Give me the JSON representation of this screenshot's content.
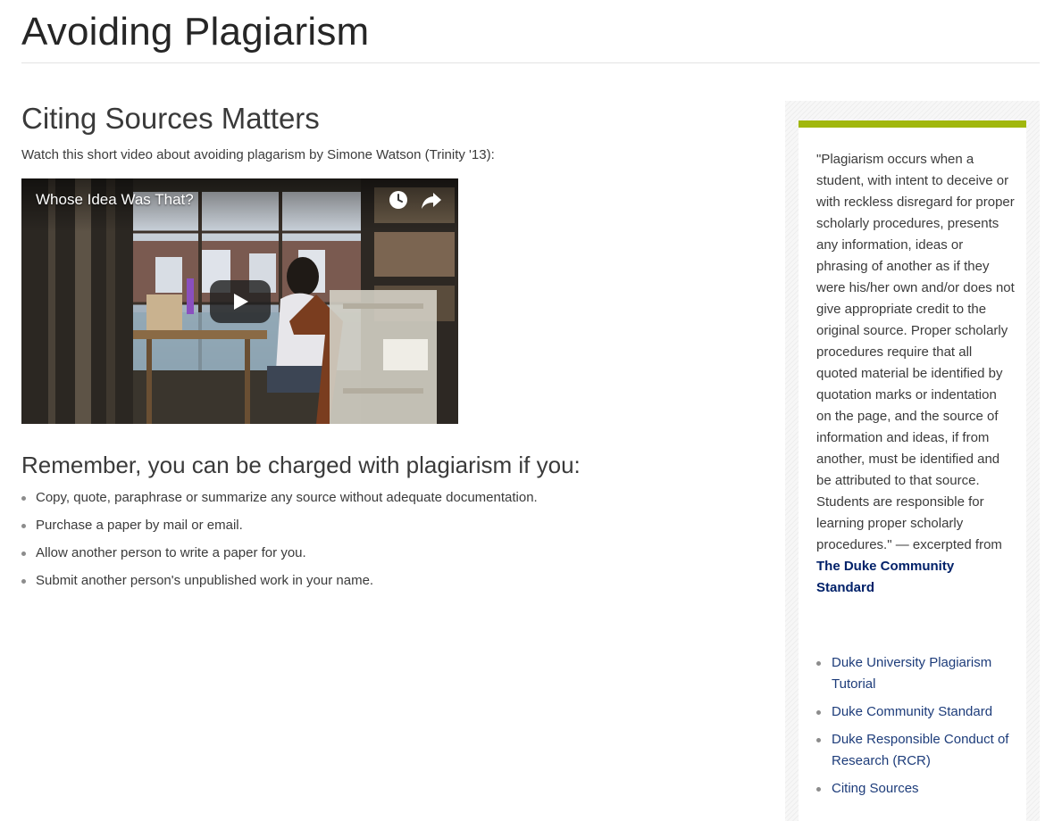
{
  "page": {
    "title": "Avoiding Plagiarism"
  },
  "main": {
    "section_heading": "Citing Sources Matters",
    "intro": "Watch this short video about avoiding plagarism by Simone Watson (Trinity '13):",
    "video": {
      "title": "Whose Idea Was That?",
      "icons": [
        "clock-icon",
        "share-icon",
        "play-icon"
      ]
    },
    "remember_heading": "Remember, you can be charged with plagiarism if you:",
    "remember_items": [
      "Copy, quote, paraphrase or summarize any source without adequate documentation.",
      "Purchase a paper by mail or email.",
      "Allow another person to write a paper for you.",
      "Submit another person's unpublished work in your name."
    ]
  },
  "sidebar": {
    "accent_color": "#a1b70d",
    "quote_text": "\"Plagiarism occurs when a student, with intent to deceive or with reckless disregard for proper scholarly procedures, presents any information, ideas or phrasing of another as if they were his/her own and/or does not give appropriate credit to the original source. Proper scholarly procedures require that all quoted material be identified by quotation marks or indentation on the page, and the source of information and ideas, if from another, must be identified and be attributed to that source. Students are responsible for learning proper scholarly procedures.\"",
    "excerpt_prefix": " — excerpted from ",
    "source_link": "The Duke Community Standard",
    "links": [
      "Duke University Plagiarism Tutorial",
      "Duke Community Standard",
      "Duke Responsible Conduct of Research (RCR)",
      "Citing Sources"
    ]
  }
}
